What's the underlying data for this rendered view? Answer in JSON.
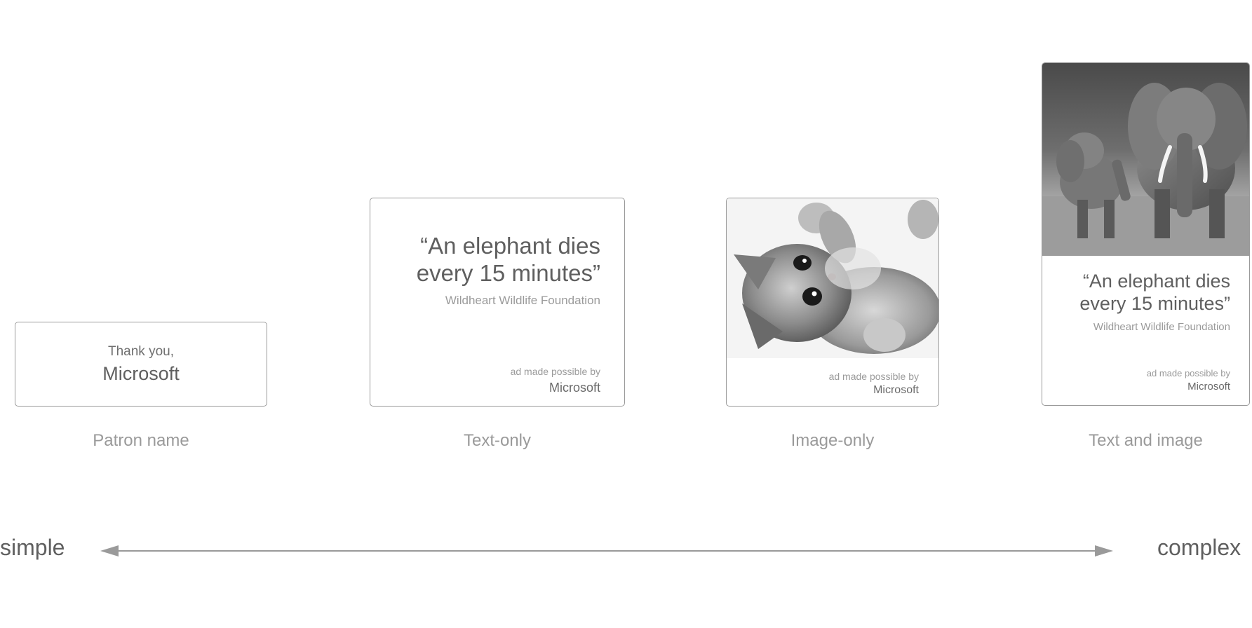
{
  "cards": {
    "patron": {
      "thanks": "Thank you,",
      "patron": "Microsoft",
      "caption": "Patron name"
    },
    "text_only": {
      "quote_line1": "“An elephant dies",
      "quote_line2": "every 15 minutes”",
      "org": "Wildheart Wildlife Foundation",
      "possible_by": "ad made possible by",
      "sponsor": "Microsoft",
      "caption": "Text-only"
    },
    "image_only": {
      "image_subject": "kitten-photo",
      "possible_by": "ad made possible by",
      "sponsor": "Microsoft",
      "caption": "Image-only"
    },
    "text_image": {
      "image_subject": "elephants-photo",
      "quote_line1": "“An elephant dies",
      "quote_line2": "every 15 minutes”",
      "org": "Wildheart Wildlife Foundation",
      "possible_by": "ad made possible by",
      "sponsor": "Microsoft",
      "caption": "Text and image"
    }
  },
  "scale": {
    "left_label": "simple",
    "right_label": "complex"
  },
  "colors": {
    "border": "#9a9a9a",
    "text_dark": "#5f5f5f",
    "text_light": "#9a9a9a"
  }
}
